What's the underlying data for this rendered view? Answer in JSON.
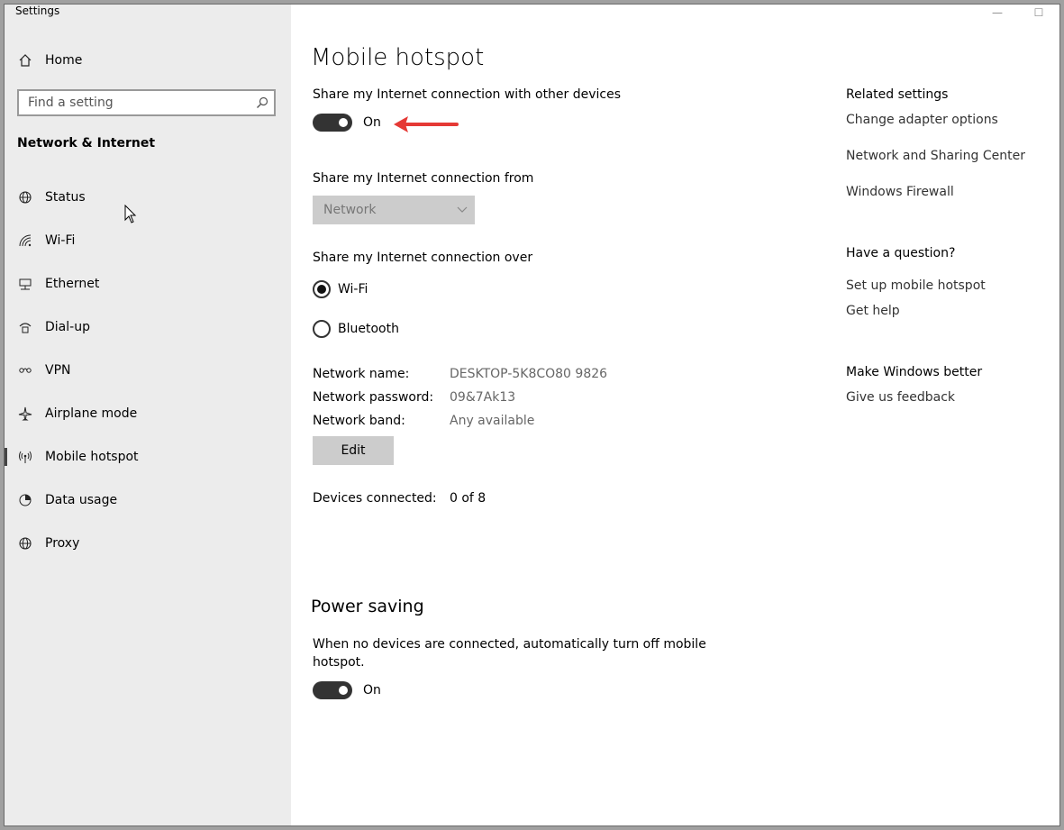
{
  "window": {
    "title": "Settings",
    "minimize": "—",
    "maximize": "☐"
  },
  "sidebar": {
    "home": "Home",
    "search_placeholder": "Find a setting",
    "section": "Network & Internet",
    "items": [
      {
        "label": "Status",
        "icon": "globe-status-icon"
      },
      {
        "label": "Wi-Fi",
        "icon": "wifi-icon"
      },
      {
        "label": "Ethernet",
        "icon": "ethernet-icon"
      },
      {
        "label": "Dial-up",
        "icon": "dialup-icon"
      },
      {
        "label": "VPN",
        "icon": "vpn-icon"
      },
      {
        "label": "Airplane mode",
        "icon": "airplane-icon"
      },
      {
        "label": "Mobile hotspot",
        "icon": "hotspot-icon"
      },
      {
        "label": "Data usage",
        "icon": "data-usage-icon"
      },
      {
        "label": "Proxy",
        "icon": "proxy-globe-icon"
      }
    ],
    "active": "Mobile hotspot"
  },
  "main": {
    "title": "Mobile hotspot",
    "share_label": "Share my Internet connection with other devices",
    "share_toggle": {
      "state": "On"
    },
    "from_label": "Share my Internet connection from",
    "from_value": "Network",
    "over_label": "Share my Internet connection over",
    "over_options": [
      {
        "label": "Wi-Fi",
        "checked": true
      },
      {
        "label": "Bluetooth",
        "checked": false
      }
    ],
    "network": {
      "name_label": "Network name:",
      "name_value": "DESKTOP-5K8CO80 9826",
      "password_label": "Network password:",
      "password_value": "09&7Ak13",
      "band_label": "Network band:",
      "band_value": "Any available"
    },
    "edit_label": "Edit",
    "devices_label": "Devices connected:",
    "devices_value": "0 of 8",
    "power_title": "Power saving",
    "power_desc_line1": "When no devices are connected, automatically turn off mobile",
    "power_desc_line2": "hotspot.",
    "power_toggle": {
      "state": "On"
    }
  },
  "related": {
    "heading": "Related settings",
    "links": [
      "Change adapter options",
      "Network and Sharing Center",
      "Windows Firewall"
    ],
    "question_heading": "Have a question?",
    "question_links": [
      "Set up mobile hotspot",
      "Get help"
    ],
    "better_heading": "Make Windows better",
    "better_links": [
      "Give us feedback"
    ]
  },
  "colors": {
    "annotation_arrow": "#e53935",
    "sidebar_bg": "#ececec",
    "toggle_on": "#333333"
  }
}
